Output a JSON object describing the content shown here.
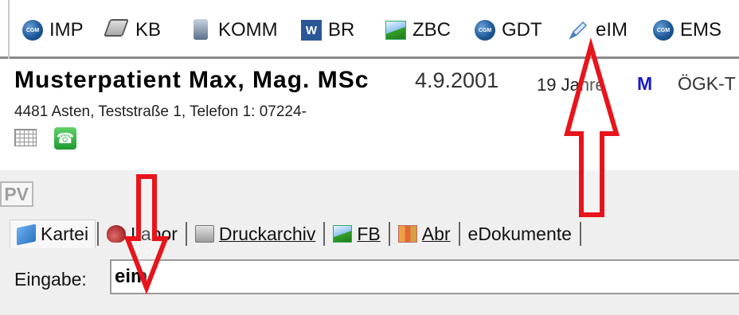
{
  "toolbar": {
    "items": [
      {
        "label": "IMP",
        "icon": "cgm-globe-icon"
      },
      {
        "label": "KB",
        "icon": "book-icon"
      },
      {
        "label": "KOMM",
        "icon": "computer-icon"
      },
      {
        "label": "BR",
        "icon": "word-icon"
      },
      {
        "label": "ZBC",
        "icon": "chart-icon"
      },
      {
        "label": "GDT",
        "icon": "cgm-globe-icon"
      },
      {
        "label": "eIM",
        "icon": "pen-icon"
      },
      {
        "label": "EMS",
        "icon": "cgm-globe-icon"
      }
    ]
  },
  "patient": {
    "name": "Musterpatient Max, Mag. MSc",
    "dob": "4.9.2001",
    "age": "19 Jahre",
    "sex": "M",
    "insurance": "ÖGK-T",
    "address": "4481 Asten, Teststraße 1, Telefon 1: 07224-"
  },
  "panel": {
    "badge": "PV"
  },
  "tabs": [
    {
      "label": "Kartei"
    },
    {
      "label": "Labor"
    },
    {
      "label": "Druckarchiv"
    },
    {
      "label": "FB"
    },
    {
      "label": "Abr"
    },
    {
      "label": "eDokumente"
    }
  ],
  "input": {
    "label": "Eingabe:",
    "value": "eim"
  },
  "colors": {
    "annotation_arrow": "#e8141c",
    "sex_marker": "#1919c8"
  }
}
